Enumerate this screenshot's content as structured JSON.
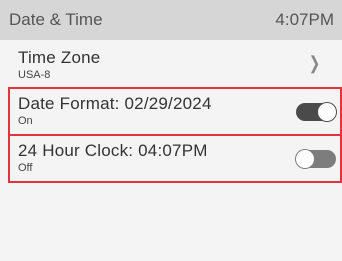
{
  "status_bar": {
    "title": "Date & Time",
    "time": "4:07PM"
  },
  "settings": {
    "time_zone": {
      "title": "Time Zone",
      "value": "USA-8",
      "icon": "chevron-right-icon"
    },
    "date_format": {
      "title": "Date Format: 02/29/2024",
      "state": "On",
      "enabled": true
    },
    "clock_24h": {
      "title": "24 Hour Clock: 04:07PM",
      "state": "Off",
      "enabled": false
    }
  },
  "colors": {
    "status_bar_bg": "#d6d6d6",
    "screen_bg": "#f4f4f4",
    "highlight": "#e3343b",
    "toggle_on": "#4a4a4a",
    "toggle_off": "#7d7d7d"
  }
}
